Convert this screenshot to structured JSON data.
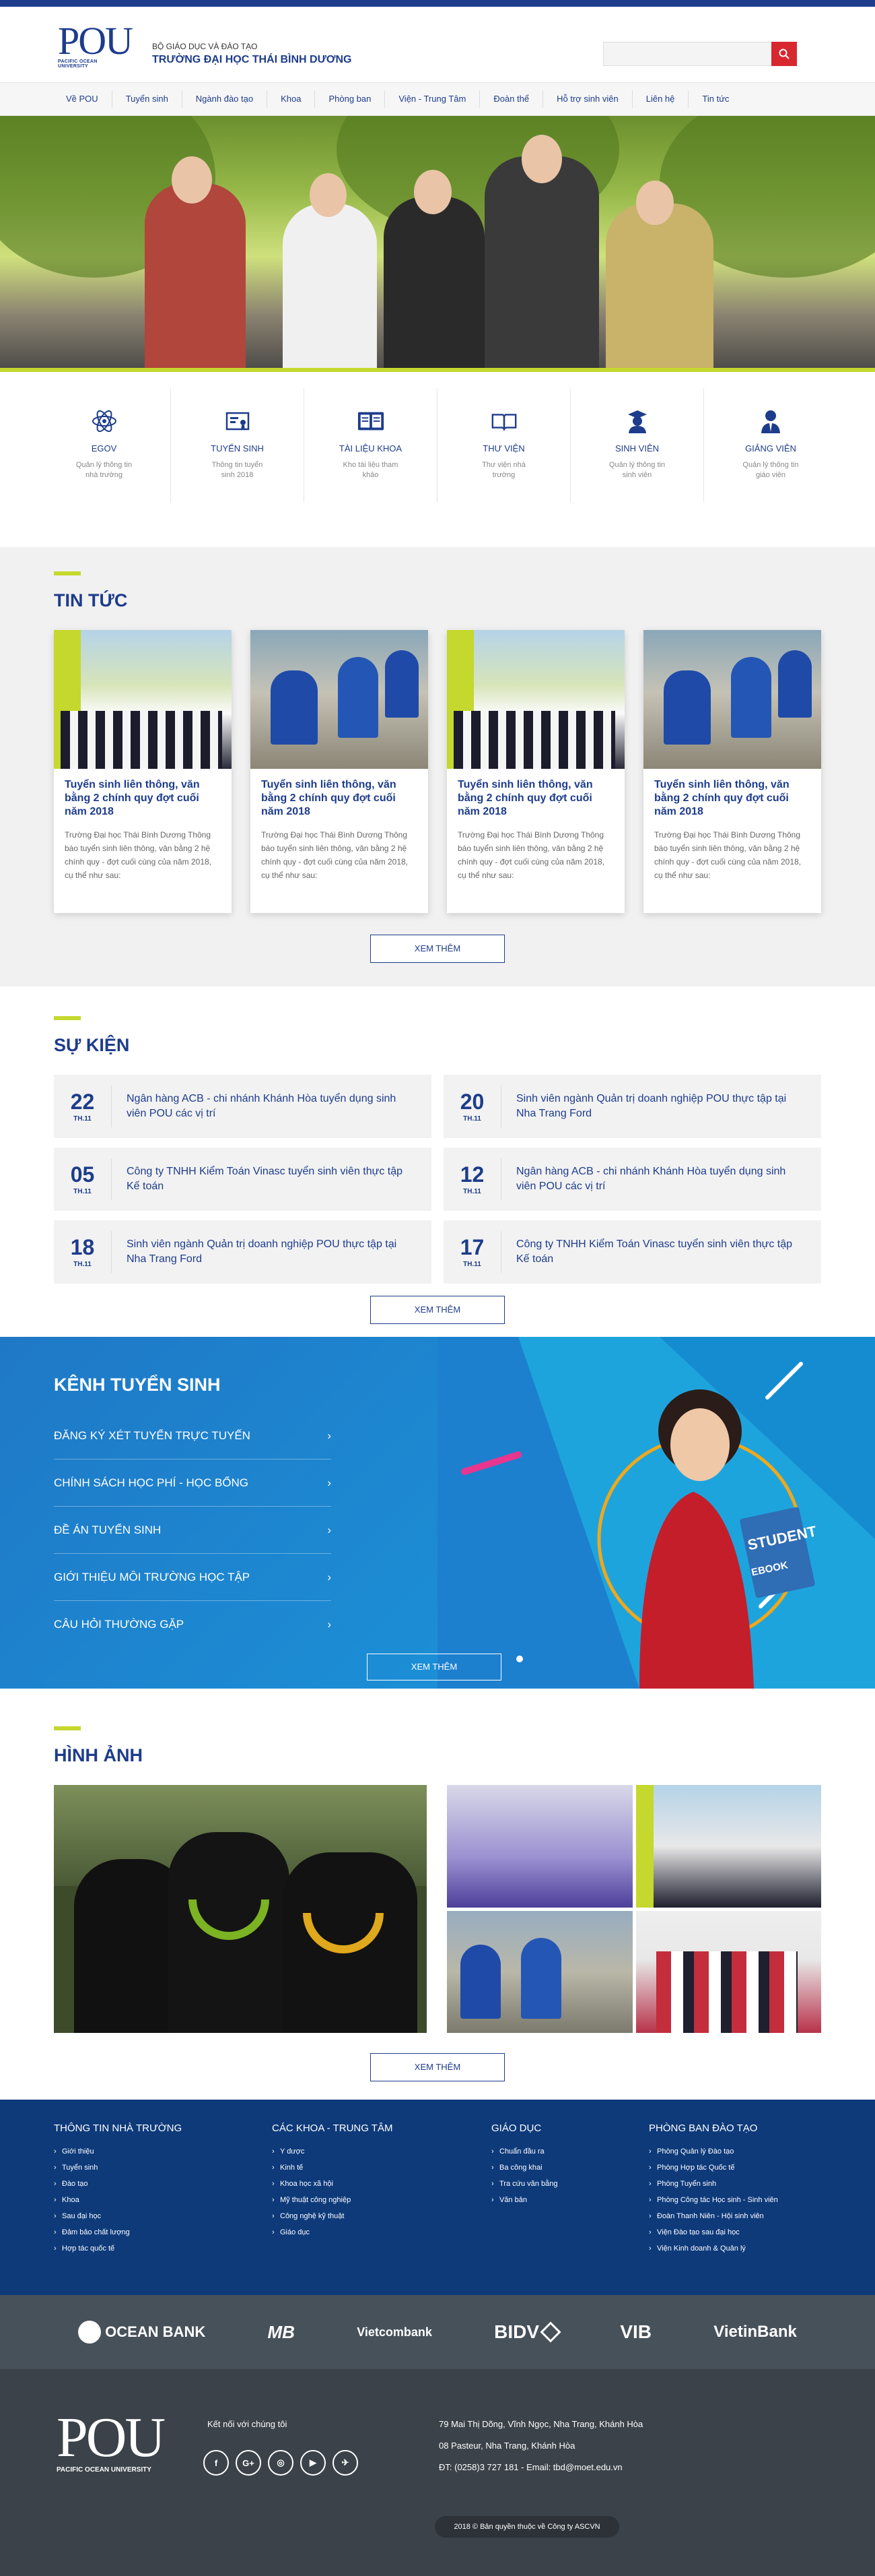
{
  "header": {
    "ministry": "BỘ GIÁO DỤC VÀ ĐÀO TẠO",
    "school": "TRƯỜNG ĐẠI HỌC THÁI BÌNH DƯƠNG",
    "logo_text": "POU",
    "logo_sub": "PACIFIC OCEAN UNIVERSITY",
    "search_placeholder": ""
  },
  "nav": [
    "Về POU",
    "Tuyển sinh",
    "Ngành đào tạo",
    "Khoa",
    "Phòng ban",
    "Viện - Trung Tâm",
    "Đoàn thể",
    "Hỗ trợ sinh viên",
    "Liên hệ",
    "Tin tức"
  ],
  "services": [
    {
      "icon": "atom-icon",
      "title": "EGOV",
      "desc": "Quản lý thông tin nhà trường"
    },
    {
      "icon": "certificate-icon",
      "title": "TUYỂN SINH",
      "desc": "Thông tin tuyển sinh 2018"
    },
    {
      "icon": "book-icon",
      "title": "TÀI LIỆU KHOA",
      "desc": "Kho tài liệu tham khảo"
    },
    {
      "icon": "open-book-icon",
      "title": "THƯ VIỆN",
      "desc": "Thư viện nhà trường"
    },
    {
      "icon": "graduate-icon",
      "title": "SINH VIÊN",
      "desc": "Quản lý thông tin sinh viên"
    },
    {
      "icon": "teacher-icon",
      "title": "GIẢNG VIÊN",
      "desc": "Quản lý thông tin giáo viên"
    }
  ],
  "news": {
    "title": "TIN TỨC",
    "items": [
      {
        "title": "Tuyển sinh liên thông, văn bằng 2 chính quy đợt cuối năm 2018",
        "desc": "Trường Đại học Thái Bình Dương Thông báo tuyển sinh liên thông, văn bằng 2 hệ chính quy - đợt cuối cùng của năm 2018, cụ thể như sau:"
      },
      {
        "title": "Tuyển sinh liên thông, văn bằng 2 chính quy đợt cuối năm 2018",
        "desc": "Trường Đại học Thái Bình Dương Thông báo tuyển sinh liên thông, văn bằng 2 hệ chính quy - đợt cuối cùng của năm 2018, cụ thể như sau:"
      },
      {
        "title": "Tuyển sinh liên thông, văn bằng 2 chính quy đợt cuối năm 2018",
        "desc": "Trường Đại học Thái Bình Dương Thông báo tuyển sinh liên thông, văn bằng 2 hệ chính quy - đợt cuối cùng của năm 2018, cụ thể như sau:"
      },
      {
        "title": "Tuyển sinh liên thông, văn bằng 2 chính quy đợt cuối năm 2018",
        "desc": "Trường Đại học Thái Bình Dương Thông báo tuyển sinh liên thông, văn bằng 2 hệ chính quy - đợt cuối cùng của năm 2018, cụ thể như sau:"
      }
    ],
    "more": "XEM THÊM"
  },
  "events": {
    "title": "SỰ KIỆN",
    "items": [
      {
        "day": "22",
        "month": "TH.11",
        "text": "Ngân hàng ACB - chi nhánh Khánh Hòa tuyển dụng sinh viên POU các vị trí"
      },
      {
        "day": "20",
        "month": "TH.11",
        "text": "Sinh viên ngành Quản trị doanh nghiệp POU thực tập tại Nha Trang Ford"
      },
      {
        "day": "05",
        "month": "TH.11",
        "text": "Công ty TNHH Kiểm Toán Vinasc tuyển sinh viên thực tập Kế toán"
      },
      {
        "day": "12",
        "month": "TH.11",
        "text": "Ngân hàng ACB - chi nhánh Khánh Hòa tuyển dụng sinh viên POU các vị trí"
      },
      {
        "day": "18",
        "month": "TH.11",
        "text": "Sinh viên ngành Quản trị doanh nghiệp POU thực tập tại Nha Trang Ford"
      },
      {
        "day": "17",
        "month": "TH.11",
        "text": "Công ty TNHH Kiểm Toán Vinasc tuyển sinh viên thực tập Kế toán"
      }
    ],
    "more": "XEM THÊM"
  },
  "admission": {
    "title": "KÊNH TUYỂN SINH",
    "items": [
      "Đăng ký xét tuyển trực tuyến",
      "Chính sách học phí - học bổng",
      "Đề án tuyển sinh",
      "Giới thiệu môi trường học tập",
      "Câu hỏi thường gặp"
    ],
    "more": "XEM THÊM",
    "book_top": "STUDENT",
    "book_label": "EBOOK"
  },
  "photos": {
    "title": "HÌNH ẢNH",
    "more": "XEM THÊM"
  },
  "footer": {
    "cols": [
      {
        "title": "THÔNG TIN NHÀ TRƯỜNG",
        "items": [
          "Giới thiệu",
          "Tuyển sinh",
          "Đào tạo",
          "Khoa",
          "Sau đại học",
          "Đảm bảo chất lượng",
          "Hợp tác quốc tế"
        ]
      },
      {
        "title": "CÁC KHOA - TRUNG TÂM",
        "items": [
          "Y dược",
          "Kinh tế",
          "Khoa học xã hội",
          "Mỹ thuật công nghiệp",
          "Công nghệ kỹ thuật",
          "Giáo dục"
        ]
      },
      {
        "title": "GIÁO DỤC",
        "items": [
          "Chuẩn đầu ra",
          "Ba công khai",
          "Tra cứu văn bằng",
          "Văn bản"
        ]
      },
      {
        "title": "PHÒNG BAN ĐÀO TẠO",
        "items": [
          "Phòng Quản lý Đào tạo",
          "Phòng Hợp tác Quốc tế",
          "Phòng Tuyển sinh",
          "Phòng Công tác Học sinh - Sinh viên",
          "Đoàn Thanh Niên - Hội sinh viên",
          "Viện Đào tạo sau đại học",
          "Viện Kinh doanh & Quản lý"
        ]
      }
    ]
  },
  "banks": [
    "OCEAN BANK",
    "MB",
    "Vietcombank",
    "BIDV",
    "VIB",
    "VietinBank"
  ],
  "bottom": {
    "connect": "Kết nối với chúng tôi",
    "social": [
      "f",
      "G+",
      "◎",
      "▶",
      "✈"
    ],
    "address1": "79 Mai Thị Dõng, Vĩnh Ngọc, Nha Trang, Khánh Hòa",
    "address2": "08 Pasteur, Nha Trang, Khánh Hòa",
    "contact": "ĐT: (0258)3 727 181 - Email: tbd@moet.edu.vn",
    "copyright": "2018 © Bản quyền thuộc về Công ty ASCVN"
  }
}
